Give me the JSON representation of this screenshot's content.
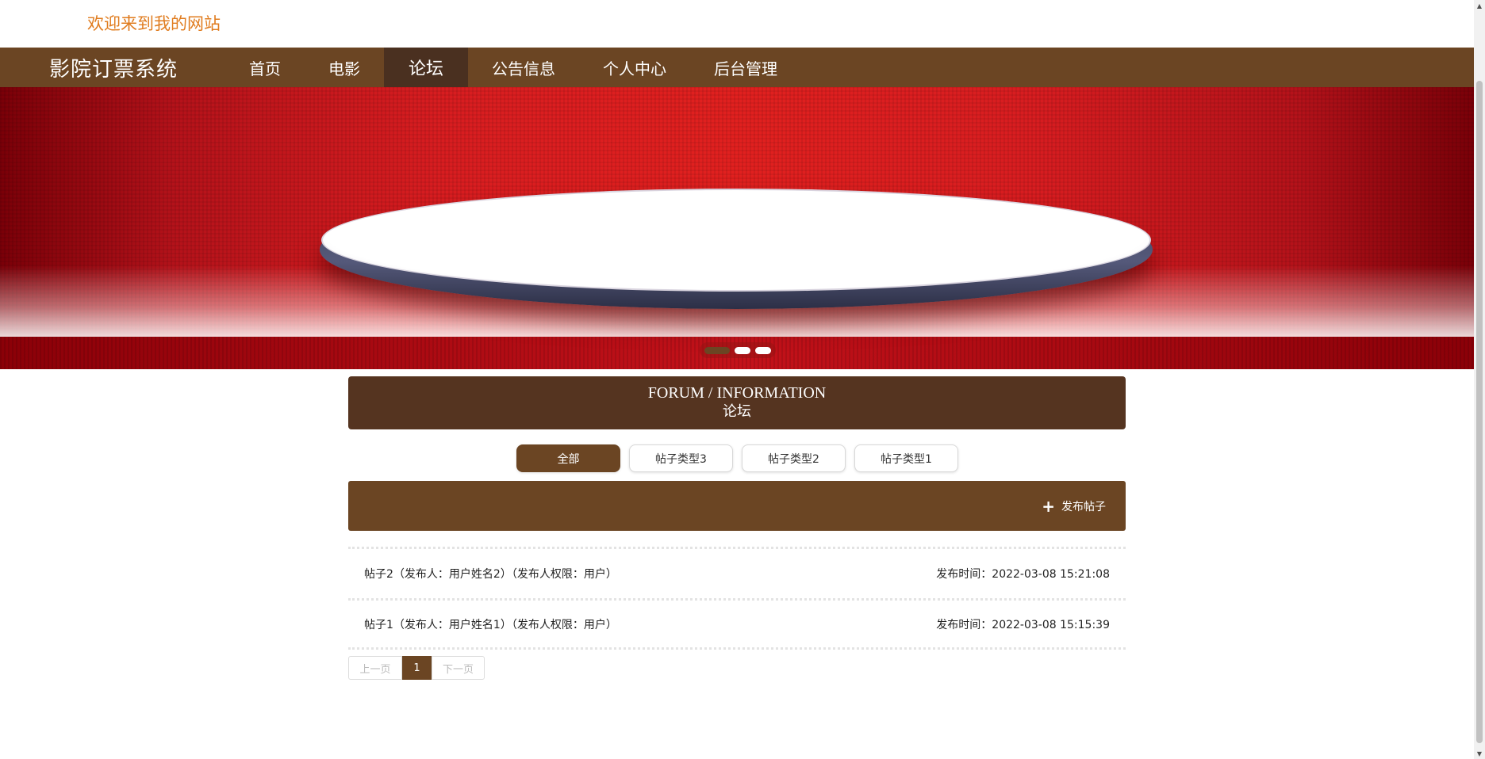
{
  "header": {
    "welcome": "欢迎来到我的网站"
  },
  "nav": {
    "brand": "影院订票系统",
    "items": [
      {
        "label": "首页"
      },
      {
        "label": "电影"
      },
      {
        "label": "论坛",
        "active": true
      },
      {
        "label": "公告信息"
      },
      {
        "label": "个人中心"
      },
      {
        "label": "后台管理"
      }
    ]
  },
  "banner": {
    "slides": 3,
    "active_slide": 1
  },
  "section": {
    "title_en": "FORUM / INFORMATION",
    "title_cn": "论坛"
  },
  "filters": [
    {
      "label": "全部",
      "active": true
    },
    {
      "label": "帖子类型3"
    },
    {
      "label": "帖子类型2"
    },
    {
      "label": "帖子类型1"
    }
  ],
  "actions": {
    "post_label": "发布帖子",
    "post_icon": "plus-icon"
  },
  "posts": [
    {
      "title": "帖子2（发布人：用户姓名2）（发布人权限：用户）",
      "time": "发布时间：2022-03-08 15:21:08"
    },
    {
      "title": "帖子1（发布人：用户姓名1）（发布人权限：用户）",
      "time": "发布时间：2022-03-08 15:15:39"
    }
  ],
  "pager": {
    "prev": "上一页",
    "current": "1",
    "next": "下一页"
  },
  "colors": {
    "primary": "#6b4523",
    "title_bg": "#553420",
    "welcome": "#e07c1f"
  }
}
